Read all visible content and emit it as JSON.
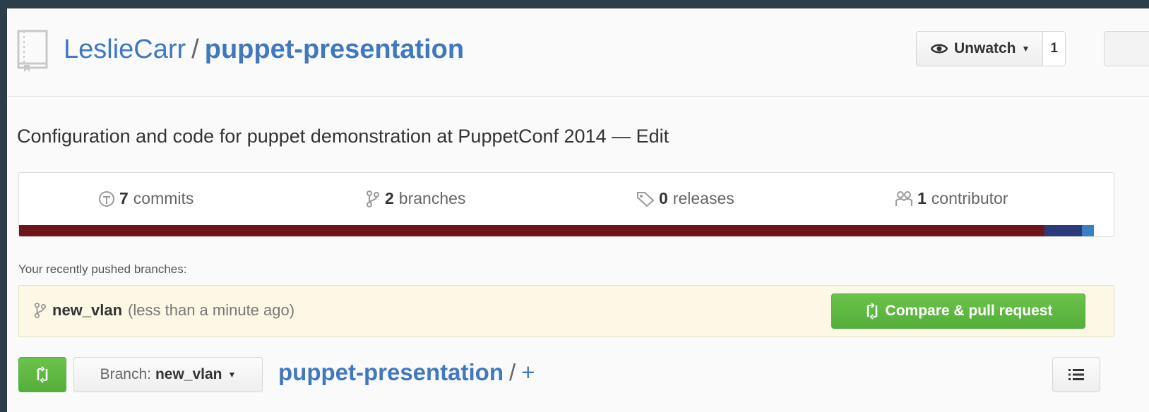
{
  "header": {
    "owner": "LeslieCarr",
    "separator": "/",
    "repo": "puppet-presentation",
    "watch_label": "Unwatch",
    "watch_count": "1"
  },
  "description": {
    "text": "Configuration and code for puppet demonstration at PuppetConf 2014",
    "dash": "—",
    "edit_label": "Edit"
  },
  "stats": {
    "commits_count": "7",
    "commits_label": "commits",
    "branches_count": "2",
    "branches_label": "branches",
    "releases_count": "0",
    "releases_label": "releases",
    "contributors_count": "1",
    "contributors_label": "contributor"
  },
  "language_bar": [
    {
      "color": "#6e151b",
      "share": 0.937
    },
    {
      "color": "#2d3a7a",
      "share": 0.034
    },
    {
      "color": "#3c7fc2",
      "share": 0.011
    }
  ],
  "recent_branches": {
    "label": "Your recently pushed branches:",
    "branch_name": "new_vlan",
    "time_ago": "(less than a minute ago)",
    "compare_label": "Compare & pull request"
  },
  "file_nav": {
    "branch_prefix": "Branch:",
    "branch_name": "new_vlan",
    "repo_crumb": "puppet-presentation",
    "separator": "/",
    "add_label": "+"
  },
  "icons": [
    "repo-icon",
    "eye-icon",
    "commit-icon",
    "branch-icon",
    "tag-icon",
    "contributors-icon",
    "compare-icon",
    "list-icon"
  ],
  "colors": {
    "link": "#4078c0",
    "green": "#55a532",
    "highlight": "#fcf8e5"
  }
}
